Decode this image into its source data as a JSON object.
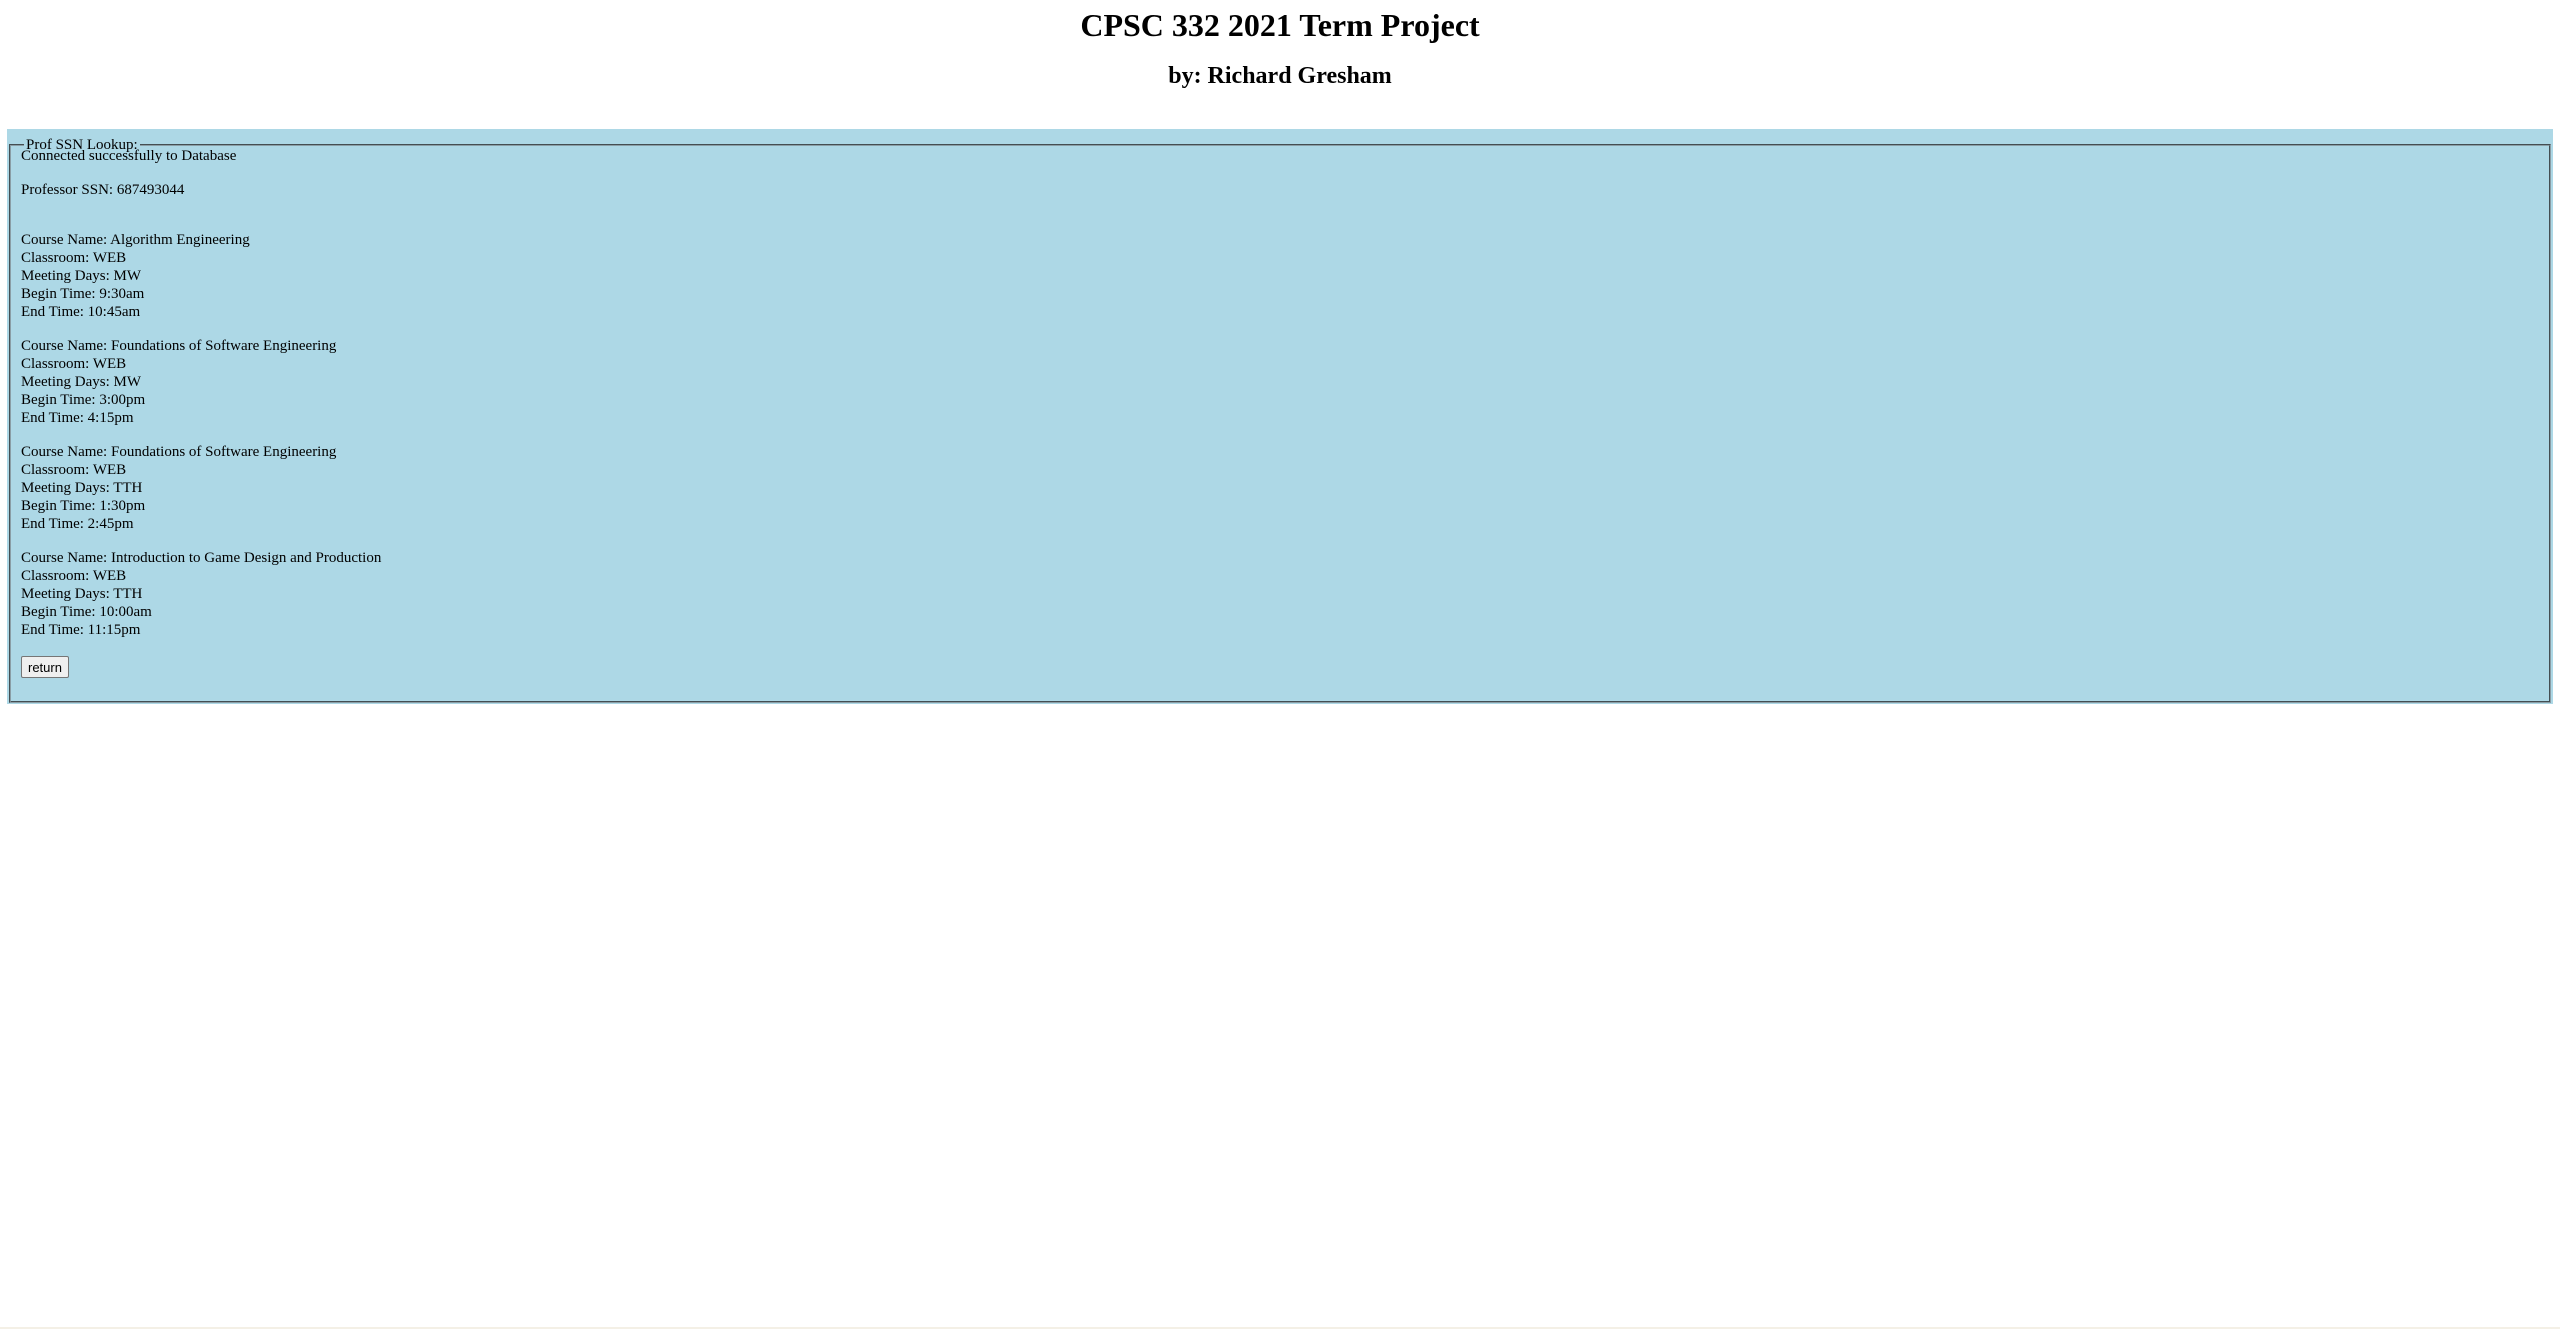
{
  "header": {
    "title": "CPSC 332 2021 Term Project",
    "subtitle": "by: Richard Gresham"
  },
  "lookup": {
    "legend": "Prof SSN Lookup:",
    "status": "Connected successfully to Database",
    "ssn_line": "Professor SSN: 687493044",
    "courses": [
      {
        "name": "Course Name: Algorithm Engineering",
        "classroom": "Classroom: WEB",
        "days": "Meeting Days: MW",
        "begin": "Begin Time: 9:30am",
        "end": "End Time: 10:45am"
      },
      {
        "name": "Course Name: Foundations of Software Engineering",
        "classroom": "Classroom: WEB",
        "days": "Meeting Days: MW",
        "begin": "Begin Time: 3:00pm",
        "end": "End Time: 4:15pm"
      },
      {
        "name": "Course Name: Foundations of Software Engineering",
        "classroom": "Classroom: WEB",
        "days": "Meeting Days: TTH",
        "begin": "Begin Time: 1:30pm",
        "end": "End Time: 2:45pm"
      },
      {
        "name": "Course Name: Introduction to Game Design and Production",
        "classroom": "Classroom: WEB",
        "days": "Meeting Days: TTH",
        "begin": "Begin Time: 10:00am",
        "end": "End Time: 11:15pm"
      }
    ],
    "return_label": "return"
  },
  "colors": {
    "panel_background": "#add8e6",
    "page_background": "#ffffff"
  }
}
